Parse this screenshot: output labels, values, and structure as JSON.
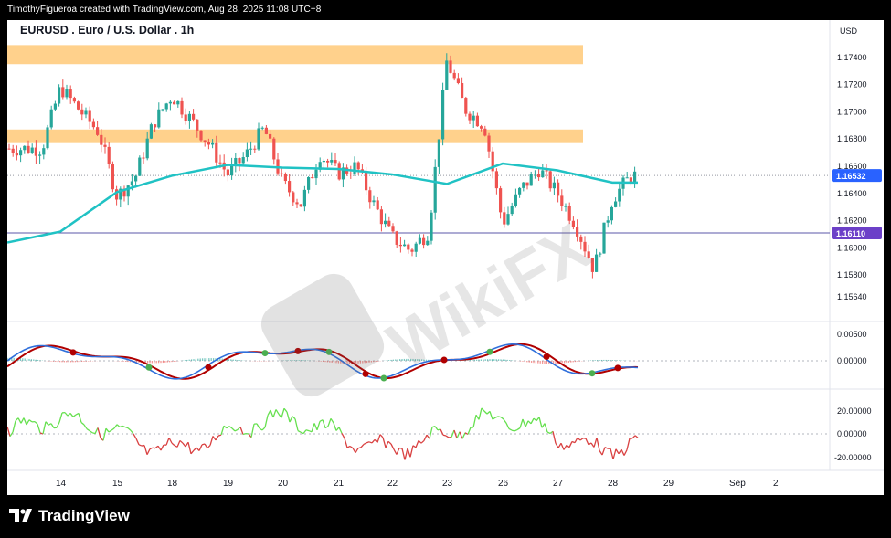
{
  "header": {
    "credit": "TimothyFigueroa created with TradingView.com, Aug 28, 2025 11:08 UTC+8"
  },
  "symbol": {
    "title": "EURUSD . Euro / U.S. Dollar . 1h",
    "currency": "USD"
  },
  "price_axis": {
    "ticks": [
      "1.17400",
      "1.17200",
      "1.17000",
      "1.16800",
      "1.16600",
      "1.16400",
      "1.16200",
      "1.16000",
      "1.15800",
      "1.15640"
    ],
    "current_price": "1.16532",
    "line_price": "1.16110"
  },
  "osc_axis": {
    "ticks": [
      "0.00500",
      "0.00000"
    ]
  },
  "rsi_axis": {
    "ticks": [
      "20.00000",
      "0.00000",
      "-20.00000"
    ]
  },
  "time_axis": {
    "labels": [
      "14",
      "15",
      "18",
      "19",
      "20",
      "21",
      "22",
      "23",
      "26",
      "27",
      "28",
      "29",
      "Sep",
      "2"
    ]
  },
  "footer": {
    "brand": "TradingView"
  },
  "watermark": {
    "text": "WikiFX"
  },
  "colors": {
    "up": "#26a69a",
    "down": "#ef5350",
    "ma": "#20c2c4",
    "zone": "#ffc978",
    "hline": "#5b57a8",
    "last_price_bg": "#2962ff",
    "hline_bg": "#6c40c8",
    "macd_fast": "#2f6fdb",
    "rsi_up": "#66e04f",
    "rsi_down": "#d94141"
  },
  "chart_data": {
    "type": "candlestick",
    "title": "EURUSD . Euro / U.S. Dollar . 1h",
    "ylim": [
      1.1556,
      1.1762
    ],
    "resistance_zones": [
      [
        1.1735,
        1.1749
      ],
      [
        1.1677,
        1.1687
      ]
    ],
    "horizontal_line": 1.1611,
    "last_price": 1.16532,
    "moving_average": [
      {
        "day": "14",
        "value": 1.1612
      },
      {
        "day": "15",
        "value": 1.1641
      },
      {
        "day": "18",
        "value": 1.1653
      },
      {
        "day": "19",
        "value": 1.1661
      },
      {
        "day": "20",
        "value": 1.1659
      },
      {
        "day": "21",
        "value": 1.1658
      },
      {
        "day": "22",
        "value": 1.1654
      },
      {
        "day": "23",
        "value": 1.1647
      },
      {
        "day": "26",
        "value": 1.1662
      },
      {
        "day": "27",
        "value": 1.1657
      },
      {
        "day": "28",
        "value": 1.1648
      }
    ],
    "price_path": [
      {
        "day": "14",
        "close": 1.1673
      },
      {
        "day": "14",
        "close": 1.1718
      },
      {
        "day": "14",
        "close": 1.1702
      },
      {
        "day": "15",
        "close": 1.1685
      },
      {
        "day": "15",
        "close": 1.1638
      },
      {
        "day": "15",
        "close": 1.1652
      },
      {
        "day": "18",
        "close": 1.1692
      },
      {
        "day": "18",
        "close": 1.1712
      },
      {
        "day": "18",
        "close": 1.1695
      },
      {
        "day": "19",
        "close": 1.1676
      },
      {
        "day": "19",
        "close": 1.1654
      },
      {
        "day": "19",
        "close": 1.1668
      },
      {
        "day": "20",
        "close": 1.1688
      },
      {
        "day": "20",
        "close": 1.1648
      },
      {
        "day": "20",
        "close": 1.1632
      },
      {
        "day": "21",
        "close": 1.1669
      },
      {
        "day": "21",
        "close": 1.1655
      },
      {
        "day": "21",
        "close": 1.166
      },
      {
        "day": "22",
        "close": 1.1632
      },
      {
        "day": "22",
        "close": 1.1608
      },
      {
        "day": "22",
        "close": 1.1598
      },
      {
        "day": "23",
        "close": 1.1612
      },
      {
        "day": "23",
        "close": 1.1738
      },
      {
        "day": "23",
        "close": 1.1702
      },
      {
        "day": "26",
        "close": 1.169
      },
      {
        "day": "26",
        "close": 1.1618
      },
      {
        "day": "26",
        "close": 1.1643
      },
      {
        "day": "27",
        "close": 1.1658
      },
      {
        "day": "27",
        "close": 1.164
      },
      {
        "day": "27",
        "close": 1.1617
      },
      {
        "day": "28",
        "close": 1.1584
      },
      {
        "day": "28",
        "close": 1.1636
      },
      {
        "day": "28",
        "close": 1.1653
      }
    ],
    "oscillator": {
      "ylim": [
        -0.006,
        0.01
      ],
      "ticks": [
        0.005,
        0.0
      ]
    },
    "rsi_like": {
      "ylim": [
        -25,
        30
      ],
      "ticks": [
        20,
        0,
        -20
      ]
    }
  }
}
